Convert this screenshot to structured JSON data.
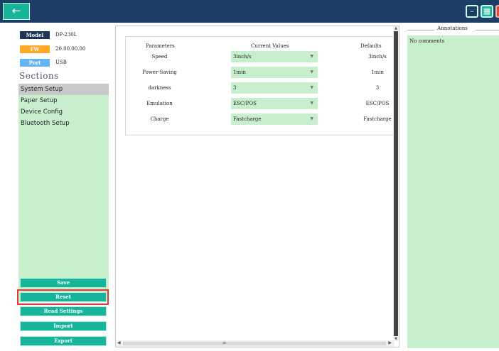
{
  "titlebar": {
    "back_icon": "arrow-left-icon",
    "minimize_icon": "minimize-icon",
    "maximize_icon": "maximize-icon",
    "close_icon": "close-icon"
  },
  "device": {
    "model_label": "Model",
    "model_value": "DP-230L",
    "fw_label": "FW",
    "fw_value": "20.00.00.00",
    "port_label": "Port",
    "port_value": "USB"
  },
  "sidebar": {
    "title": "Sections",
    "items": [
      {
        "label": "System Setup"
      },
      {
        "label": "Paper Setup"
      },
      {
        "label": "Device Config"
      },
      {
        "label": "Bluetooth Setup"
      }
    ]
  },
  "buttons": {
    "save": "Save",
    "reset": "Reset",
    "read_settings": "Read Settings",
    "import": "Import",
    "export": "Export"
  },
  "params": {
    "headers": {
      "parameters": "Parameters",
      "current": "Current Values",
      "defaults": "Defaults"
    },
    "rows": [
      {
        "name": "Speed",
        "current": "3inch/s",
        "default": "3inch/s"
      },
      {
        "name": "Power-Saving",
        "current": "1min",
        "default": "1min"
      },
      {
        "name": "darkness",
        "current": "3",
        "default": "3"
      },
      {
        "name": "Emulation",
        "current": "ESC/POS",
        "default": "ESC/POS"
      },
      {
        "name": "Charge",
        "current": "Fastcharge",
        "default": "Fastcharge"
      }
    ]
  },
  "annotations": {
    "title": "Annotations",
    "text": "No comments"
  },
  "colors": {
    "titlebar": "#1c3d66",
    "accent": "#16b59a",
    "panel": "#c8efcd",
    "model_badge": "#1f3558",
    "fw_badge": "#ffa726",
    "port_badge": "#64b5f6",
    "highlight": "#e53935"
  }
}
